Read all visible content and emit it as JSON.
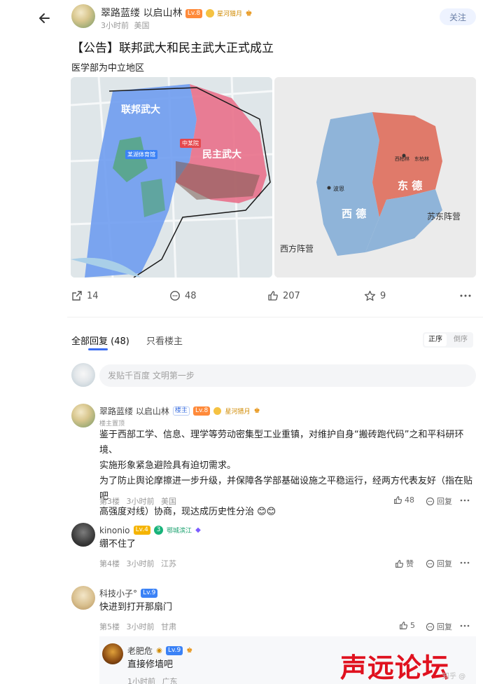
{
  "header": {
    "username": "翠路蓝缕 以启山林",
    "level": "Lv.8",
    "badge": "星河猎月",
    "time": "3小时前",
    "location": "美国",
    "follow_label": "关注"
  },
  "post": {
    "title": "【公告】联邦武大和民主武大正式成立",
    "subtitle": "医学部为中立地区",
    "map_left": {
      "label_fed": "联邦武大",
      "label_dem": "民主武大",
      "tag1": "某湖体育馆",
      "tag2": "中某院"
    },
    "map_right": {
      "label_east": "东 德",
      "label_west": "西 德",
      "label_soviet": "苏东阵营",
      "label_western": "西方阵营",
      "city1": "波恩",
      "city2": "西柏林",
      "city3": "东柏林"
    }
  },
  "actions": {
    "share": "14",
    "comment": "48",
    "like": "207",
    "star": "9"
  },
  "tabs": {
    "all": "全部回复 (48)",
    "owner_only": "只看楼主",
    "sort_asc": "正序",
    "sort_desc": "倒序"
  },
  "comment_input": {
    "placeholder": "发贴千百度 文明第一步"
  },
  "comments": [
    {
      "name": "翠路蓝缕 以启山林",
      "owner_tag": "楼主",
      "level": "Lv.8",
      "badge": "星河猎月",
      "sub": "楼主置顶",
      "text1": "鉴于西部工学、信息、理学等劳动密集型工业重镇，对维护自身“搬砖跑代码”之和平科研环境、",
      "text2": "实施形象紧急避险具有迫切需求。",
      "text3": "为了防止舆论摩擦进一步升级，并保障各学部基础设施之平稳运行，经两方代表友好（指在贴吧",
      "text4": "高强度对线）协商，现达成历史性分治 😊😊",
      "floor": "第3楼",
      "time": "3小时前",
      "location": "美国",
      "likes": "48",
      "reply": "回复"
    },
    {
      "name": "kinonio",
      "level": "Lv.4",
      "badge_num": "3",
      "badge": "鄂城滨江",
      "text": "绷不住了",
      "floor": "第4楼",
      "time": "3小时前",
      "location": "江苏",
      "likes": "赞",
      "reply": "回复"
    },
    {
      "name": "科技小子°",
      "level": "Lv.9",
      "text": "快进到打开那扇门",
      "floor": "第5楼",
      "time": "3小时前",
      "location": "甘肃",
      "likes": "5",
      "reply": "回复"
    },
    {
      "name": "老肥危",
      "level": "Lv.9",
      "text": "直接修墙吧",
      "time": "1小时前",
      "location": "广东"
    }
  ],
  "watermark": {
    "main": "声远论坛",
    "small": "知乎 @"
  },
  "colors": {
    "accent": "#3c6df0",
    "fed_blue": "#6f9cf0",
    "dem_pink": "#e8738c",
    "west_germany": "#8fb4d9",
    "east_germany": "#e07a6a",
    "watermark_red": "#e0121f"
  }
}
